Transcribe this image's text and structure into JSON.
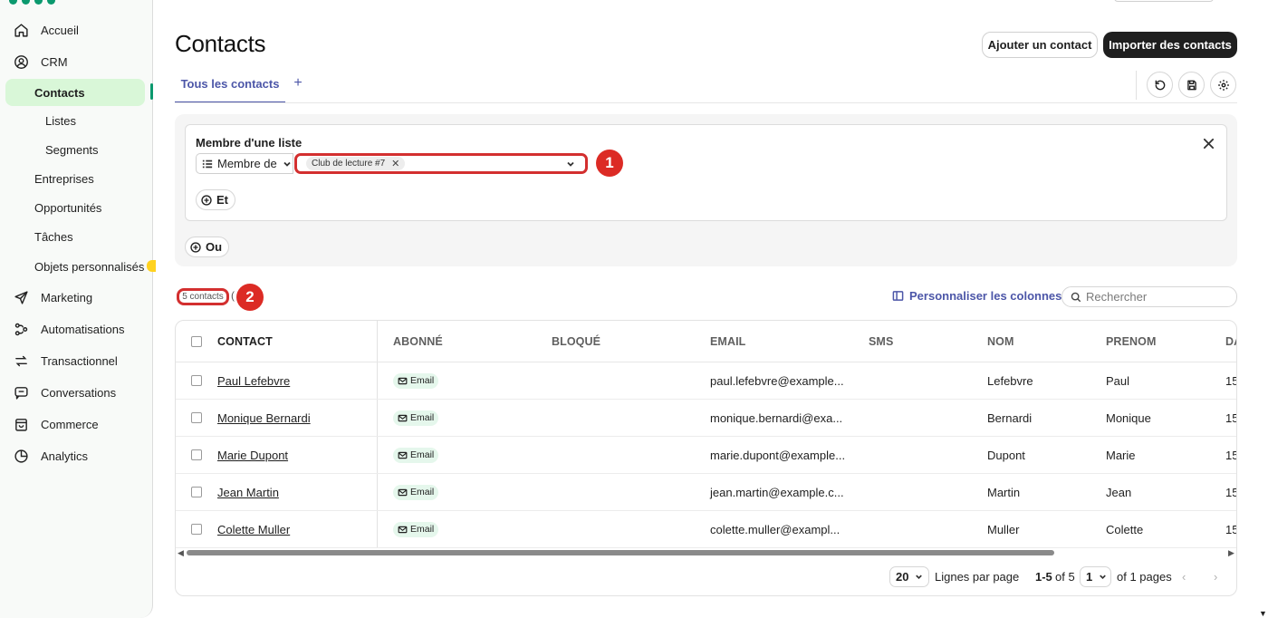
{
  "sidebar": {
    "items": [
      {
        "label": "Accueil",
        "icon": "home-icon"
      },
      {
        "label": "CRM",
        "icon": "crm-icon"
      },
      {
        "label": "Contacts"
      },
      {
        "label": "Listes"
      },
      {
        "label": "Segments"
      },
      {
        "label": "Entreprises"
      },
      {
        "label": "Opportunités"
      },
      {
        "label": "Tâches"
      },
      {
        "label": "Objets personnalisés"
      },
      {
        "label": "Marketing",
        "icon": "send-icon"
      },
      {
        "label": "Automatisations",
        "icon": "automation-icon"
      },
      {
        "label": "Transactionnel",
        "icon": "arrows-icon"
      },
      {
        "label": "Conversations",
        "icon": "chat-icon"
      },
      {
        "label": "Commerce",
        "icon": "bag-icon"
      },
      {
        "label": "Analytics",
        "icon": "pie-icon"
      }
    ]
  },
  "header": {
    "title": "Contacts",
    "add_contact_label": "Ajouter un contact",
    "import_label": "Importer des contacts"
  },
  "tabs": {
    "active_label": "Tous les contacts",
    "add_symbol": "+"
  },
  "filter": {
    "title": "Membre d'une liste",
    "operator": "Membre de",
    "selected_list": "Club de lecture #7",
    "and_label": "Et",
    "or_label": "Ou"
  },
  "callouts": {
    "first": "1",
    "second": "2"
  },
  "toolbar": {
    "count": "5 contacts",
    "count_paren": "(",
    "customize_label": "Personnaliser les colonnes",
    "search_placeholder": "Rechercher"
  },
  "table": {
    "headers": [
      "CONTACT",
      "ABONNÉ",
      "BLOQUÉ",
      "EMAIL",
      "SMS",
      "NOM",
      "PRENOM",
      "DA"
    ],
    "rows": [
      {
        "contact": "Paul Lefebvre",
        "abonne": "Email",
        "email": "paul.lefebvre@example...",
        "nom": "Lefebvre",
        "prenom": "Paul",
        "da": "15"
      },
      {
        "contact": "Monique Bernardi",
        "abonne": "Email",
        "email": "monique.bernardi@exa...",
        "nom": "Bernardi",
        "prenom": "Monique",
        "da": "15"
      },
      {
        "contact": "Marie Dupont",
        "abonne": "Email",
        "email": "marie.dupont@example...",
        "nom": "Dupont",
        "prenom": "Marie",
        "da": "15"
      },
      {
        "contact": "Jean Martin",
        "abonne": "Email",
        "email": "jean.martin@example.c...",
        "nom": "Martin",
        "prenom": "Jean",
        "da": "15"
      },
      {
        "contact": "Colette Muller",
        "abonne": "Email",
        "email": "colette.muller@exampl...",
        "nom": "Muller",
        "prenom": "Colette",
        "da": "15"
      }
    ]
  },
  "pagination": {
    "rows_per_page": "20",
    "rows_per_page_label": "Lignes par page",
    "range": "1-5",
    "of_total": "of 5",
    "page": "1",
    "of_pages": "of 1 pages"
  },
  "colors": {
    "accent": "#4c56a8",
    "brand_green": "#0b996e",
    "active_nav_bg": "#d9f7d8",
    "callout_red": "#dc2b25"
  }
}
